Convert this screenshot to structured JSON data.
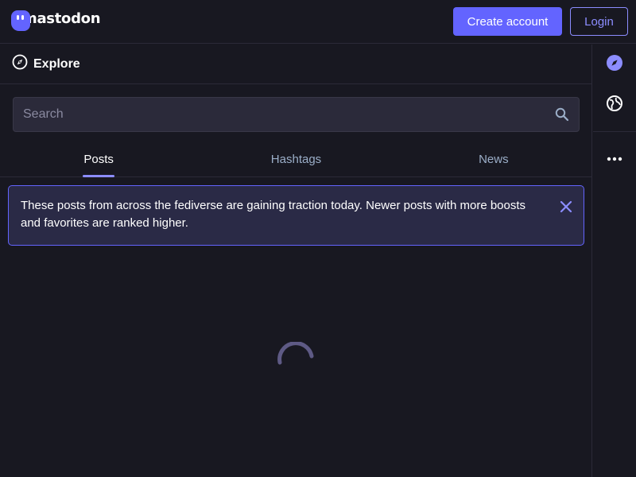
{
  "brand": {
    "name": "mastodon",
    "accent": "#6364ff",
    "accent_light": "#8c8dff"
  },
  "header": {
    "create_account_label": "Create account",
    "login_label": "Login"
  },
  "explore": {
    "title": "Explore",
    "icon": "compass-icon"
  },
  "search": {
    "placeholder": "Search",
    "value": "",
    "icon": "search-icon"
  },
  "tabs": [
    {
      "label": "Posts",
      "active": true
    },
    {
      "label": "Hashtags",
      "active": false
    },
    {
      "label": "News",
      "active": false
    }
  ],
  "notice": {
    "text": "These posts from across the fediverse are gaining traction today. Newer posts with more boosts and favorites are ranked higher.",
    "close_icon": "close-icon"
  },
  "rail": {
    "items": [
      {
        "icon": "compass-icon",
        "active": true
      },
      {
        "icon": "globe-icon",
        "active": false
      },
      {
        "icon": "more-icon",
        "active": false
      }
    ]
  },
  "loading": {
    "icon": "spinner-icon"
  }
}
